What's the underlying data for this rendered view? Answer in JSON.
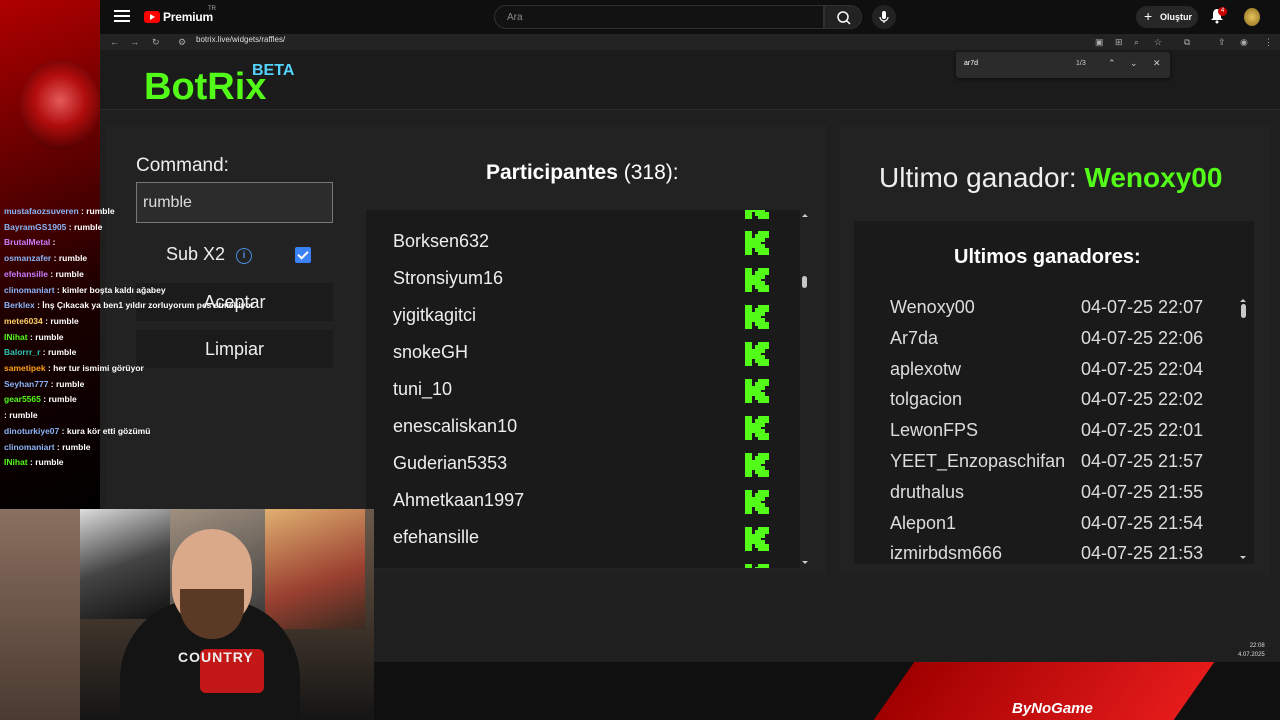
{
  "youtube": {
    "premium_label": "Premium",
    "tm": "TR",
    "search_placeholder": "Ara",
    "create_label": "Oluştur",
    "notif_count": "4"
  },
  "browser": {
    "url": "botrix.live/widgets/raffles/"
  },
  "find_bar": {
    "query": "ar7d",
    "count": "1/3"
  },
  "app": {
    "logo": "BotRix",
    "beta": "BETA"
  },
  "raffle": {
    "command_label": "Command:",
    "command_value": "rumble",
    "sub_label": "Sub X2",
    "sub_checked": true,
    "accept_label": "Aceptar",
    "clear_label": "Limpiar",
    "participants_title": "Participantes",
    "participants_count": "(318):",
    "participants": [
      "Borksen632",
      "Stronsiyum16",
      "yigitkagitci",
      "snokeGH",
      "tuni_10",
      "enescaliskan10",
      "Guderian5353",
      "Ahmetkaan1997",
      "efehansille"
    ]
  },
  "winners": {
    "last_winner_label": "Ultimo ganador:",
    "last_winner_name": "Wenoxy00",
    "list_title": "Ultimos ganadores:",
    "items": [
      {
        "name": "Wenoxy00",
        "date": "04-07-25 22:07"
      },
      {
        "name": "Ar7da",
        "date": "04-07-25 22:06"
      },
      {
        "name": "aplexotw",
        "date": "04-07-25 22:04"
      },
      {
        "name": "tolgacion",
        "date": "04-07-25 22:02"
      },
      {
        "name": "LewonFPS",
        "date": "04-07-25 22:01"
      },
      {
        "name": "YEET_Enzopaschifan",
        "date": "04-07-25 21:57"
      },
      {
        "name": "druthalus",
        "date": "04-07-25 21:55"
      },
      {
        "name": "Alepon1",
        "date": "04-07-25 21:54"
      },
      {
        "name": "izmirbdsm666",
        "date": "04-07-25 21:53"
      }
    ]
  },
  "chat": [
    {
      "user": "mustafaozsuveren",
      "color": "#8ab4f8",
      "text": "rumble"
    },
    {
      "user": "BayramGS1905",
      "color": "#8ab4f8",
      "text": "rumble"
    },
    {
      "user": "BrutalMetal",
      "color": "#c77dff",
      "text": ""
    },
    {
      "user": "osmanzafer",
      "color": "#8ab4f8",
      "text": "rumble"
    },
    {
      "user": "efehansille",
      "color": "#c77dff",
      "text": "rumble"
    },
    {
      "user": "clinomaniart",
      "color": "#8ab4f8",
      "text": "kimler boşta kaldı ağabey"
    },
    {
      "user": "Berklex",
      "color": "#8ab4f8",
      "text": "İnş Çıkacak ya ben1 yıldır zorluyorum pes etmekiyor"
    },
    {
      "user": "mete6034",
      "color": "#ffd166",
      "text": "rumble"
    },
    {
      "user": "INihat",
      "color": "#53fc18",
      "text": "rumble"
    },
    {
      "user": "Balorrr_r",
      "color": "#2ec4b6",
      "text": "rumble"
    },
    {
      "user": "sametipek",
      "color": "#ff9f1c",
      "text": "her tur ismimi görüyor"
    },
    {
      "user": "Seyhan777",
      "color": "#8ab4f8",
      "text": "rumble"
    },
    {
      "user": "gear5565",
      "color": "#53fc18",
      "text": "rumble"
    },
    {
      "user": "",
      "color": "#ff4d4d",
      "text": "rumble"
    },
    {
      "user": "dinoturkiye07",
      "color": "#8ab4f8",
      "text": "kura kör etti gözümü"
    },
    {
      "user": "clinomaniart",
      "color": "#8ab4f8",
      "text": "rumble"
    },
    {
      "user": "INihat",
      "color": "#53fc18",
      "text": "rumble"
    }
  ],
  "overlay": {
    "brand": "ByNoGame",
    "shirt_text": "COUNTRY",
    "clock_time": "22:08",
    "clock_date": "4.07.2025"
  },
  "colors": {
    "kick_green": "#53fc18",
    "beta_blue": "#53d2fc",
    "checkbox_blue": "#3b82f6"
  }
}
